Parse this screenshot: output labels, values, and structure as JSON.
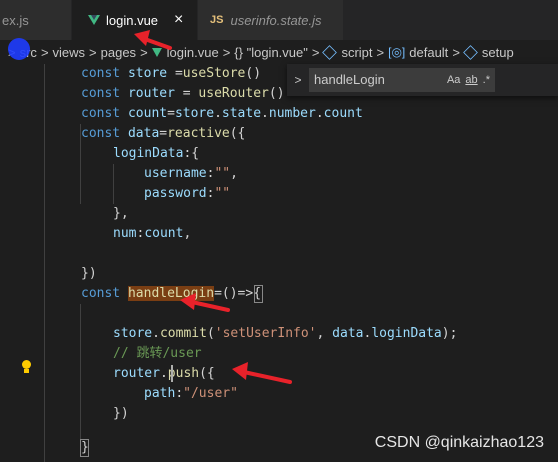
{
  "tabs": [
    {
      "label": "ex.js"
    },
    {
      "label": "login.vue",
      "close": "×"
    },
    {
      "label": "userinfo.state.js",
      "badge": "JS"
    }
  ],
  "breadcrumb": {
    "items": [
      "src",
      "views",
      "pages",
      "login.vue",
      "{} \"login.vue\"",
      "script",
      "default",
      "setup"
    ],
    "separator": ">"
  },
  "find": {
    "chevron": ">",
    "query": "handleLogin",
    "opt_case": "Aa",
    "opt_word": "ab",
    "opt_regex": ".*"
  },
  "code": {
    "l1": [
      "const",
      " store ",
      "=",
      "useStore",
      "()"
    ],
    "l2": [
      "const",
      " router ",
      "= ",
      "useRouter",
      "()"
    ],
    "l3": [
      "const",
      " count",
      "=",
      "store",
      ".",
      "state",
      ".",
      "number",
      ".",
      "count"
    ],
    "l4": [
      "const",
      " data",
      "=",
      "reactive",
      "({"
    ],
    "l5": [
      "loginData",
      ":{"
    ],
    "l6": [
      "username",
      ":",
      "\"\"",
      ","
    ],
    "l7": [
      "password",
      ":",
      "\"\""
    ],
    "l8": [
      "},"
    ],
    "l9": [
      "num",
      ":",
      "count",
      ","
    ],
    "l10": [
      "})"
    ],
    "l11": [
      "const",
      " ",
      "handleLogin",
      "=()=>{"
    ],
    "l12": [
      "store",
      ".",
      "commit",
      "(",
      "'setUserInfo'",
      ", ",
      "data",
      ".",
      "loginData",
      ");"
    ],
    "l13": [
      "// 跳转/user"
    ],
    "l14": [
      "router",
      ".",
      "pu",
      "sh",
      "({"
    ],
    "l15": [
      "path",
      ":",
      "\"/user\""
    ],
    "l16": [
      "})"
    ],
    "l17": [
      "}"
    ]
  },
  "watermark": "CSDN @qinkaizhao123",
  "colors": {
    "arrow": "#e8222a",
    "highlight": "#7a3e13",
    "bulb": "#ffcc00"
  },
  "icons": [
    "vue-icon",
    "close-icon",
    "js-icon",
    "chevron-right-icon",
    "cube-icon",
    "braces-icon",
    "field-icon",
    "lightbulb-icon"
  ]
}
